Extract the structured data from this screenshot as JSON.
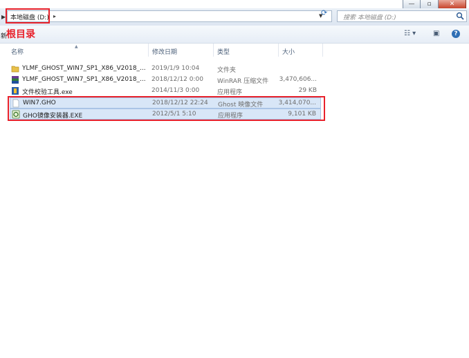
{
  "window": {
    "minimize_glyph": "—",
    "maximize_glyph": "▫",
    "close_glyph": "✕"
  },
  "address": {
    "path": "本地磁盘 (D:)",
    "separator": "▸",
    "search_placeholder": "搜索 本地磁盘 (D:)"
  },
  "toolbar": {
    "new_folder": "新",
    "annotation": "根目录",
    "views_icon": "view-options-icon",
    "preview_icon": "preview-pane-icon",
    "help_glyph": "?"
  },
  "columns": {
    "name": "名称",
    "date": "修改日期",
    "type": "类型",
    "size": "大小"
  },
  "files": [
    {
      "name": "YLMF_GHOST_WIN7_SP1_X86_V2018_...",
      "date": "2019/1/9 10:04",
      "type": "文件夹",
      "size": "",
      "icon": "folder-icon"
    },
    {
      "name": "YLMF_GHOST_WIN7_SP1_X86_V2018_...",
      "date": "2018/12/12 0:00",
      "type": "WinRAR 压缩文件",
      "size": "3,470,606...",
      "icon": "winrar-icon"
    },
    {
      "name": "文件校验工具.exe",
      "date": "2014/11/3 0:00",
      "type": "应用程序",
      "size": "29 KB",
      "icon": "checksum-tool-icon"
    },
    {
      "name": "WIN7.GHO",
      "date": "2018/12/12 22:24",
      "type": "Ghost 映像文件",
      "size": "3,414,070...",
      "icon": "blank-file-icon"
    },
    {
      "name": "GHO镜像安装器.EXE",
      "date": "2012/5/1 5:10",
      "type": "应用程序",
      "size": "9,101 KB",
      "icon": "installer-icon"
    }
  ],
  "colors": {
    "highlight": "#e8212b",
    "selection": "#d8e6f7"
  }
}
